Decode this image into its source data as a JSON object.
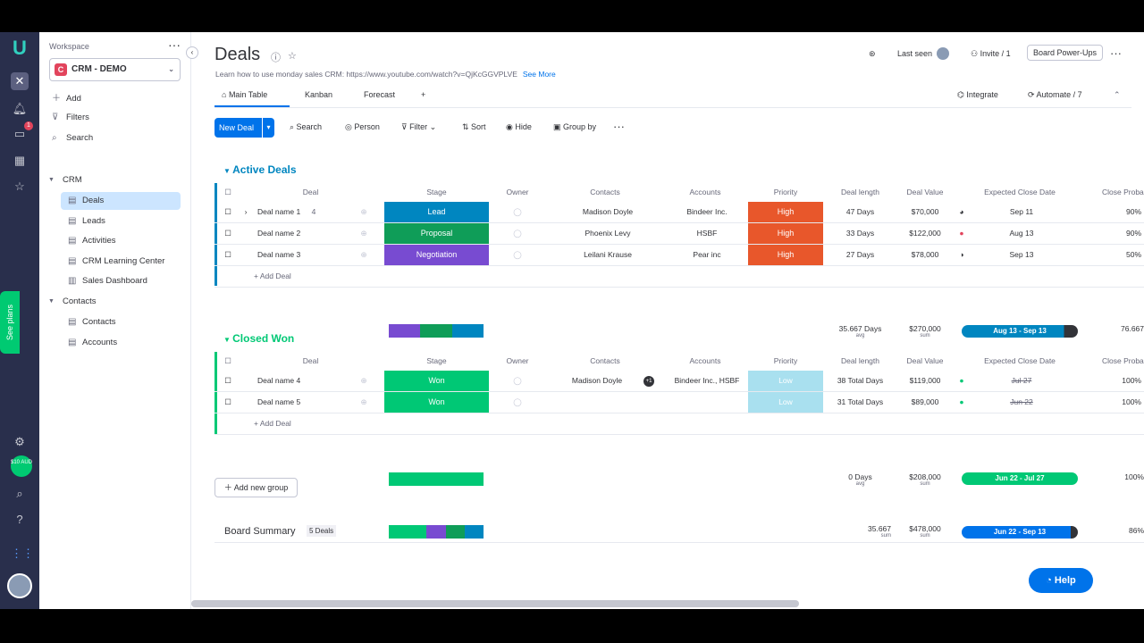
{
  "rail": {
    "badge_count": "1",
    "plan_label": "$10 AUD",
    "see_plans": "See plans"
  },
  "sidebar": {
    "workspace_label": "Workspace",
    "workspace_name": "CRM - DEMO",
    "workspace_initial": "C",
    "actions": [
      {
        "label": "Add"
      },
      {
        "label": "Filters"
      },
      {
        "label": "Search"
      }
    ],
    "folders": [
      {
        "label": "CRM",
        "items": [
          {
            "label": "Deals"
          },
          {
            "label": "Leads"
          },
          {
            "label": "Activities"
          },
          {
            "label": "CRM Learning Center"
          },
          {
            "label": "Sales Dashboard"
          }
        ]
      },
      {
        "label": "Contacts",
        "items": [
          {
            "label": "Contacts"
          },
          {
            "label": "Accounts"
          }
        ]
      }
    ]
  },
  "header": {
    "title": "Deals",
    "description": "Learn how to use monday sales CRM: https://www.youtube.com/watch?v=QjKcGGVPLVE",
    "see_more": "See More",
    "last_seen": "Last seen",
    "invite": "Invite / 1",
    "power_ups": "Board Power-Ups",
    "integrate": "Integrate",
    "automate": "Automate / 7"
  },
  "tabs": [
    {
      "label": "Main Table"
    },
    {
      "label": "Kanban"
    },
    {
      "label": "Forecast"
    },
    {
      "label": "+"
    }
  ],
  "toolbar": {
    "new_deal": "New Deal",
    "search": "Search",
    "person": "Person",
    "filter": "Filter",
    "sort": "Sort",
    "hide": "Hide",
    "group_by": "Group by"
  },
  "columns": {
    "deal": "Deal",
    "stage": "Stage",
    "owner": "Owner",
    "contacts": "Contacts",
    "accounts": "Accounts",
    "priority": "Priority",
    "deal_length": "Deal length",
    "deal_value": "Deal Value",
    "close_date": "Expected Close Date",
    "close_prob": "Close Proba"
  },
  "groups": [
    {
      "title": "Active Deals",
      "color": "#0086c0",
      "rows": [
        {
          "deal": "Deal name 1",
          "subitems": "4",
          "stage": "Lead",
          "stage_color": "#0086c0",
          "contacts": "Madison Doyle",
          "accounts": "Bindeer Inc.",
          "priority": "High",
          "priority_color": "#e8572b",
          "length": "47 Days",
          "value": "$70,000",
          "date": "Sep 11",
          "prob": "90%"
        },
        {
          "deal": "Deal name 2",
          "subitems": "",
          "stage": "Proposal",
          "stage_color": "#0f9d58",
          "contacts": "Phoenix Levy",
          "accounts": "HSBF",
          "priority": "High",
          "priority_color": "#e8572b",
          "length": "33 Days",
          "value": "$122,000",
          "date": "Aug 13",
          "prob": "90%"
        },
        {
          "deal": "Deal name 3",
          "subitems": "",
          "stage": "Negotiation",
          "stage_color": "#784bd1",
          "contacts": "Leilani Krause",
          "accounts": "Pear inc",
          "priority": "High",
          "priority_color": "#e8572b",
          "length": "27 Days",
          "value": "$78,000",
          "date": "Sep 13",
          "prob": "50%"
        }
      ],
      "add_label": "+ Add Deal",
      "sum_length": "35.667 Days",
      "sum_length_sub": "avg",
      "sum_value": "$270,000",
      "sum_value_sub": "sum",
      "sum_date": "Aug 13 - Sep 13",
      "sum_prob": "76.667"
    },
    {
      "title": "Closed Won",
      "color": "#00c875",
      "rows": [
        {
          "deal": "Deal name 4",
          "subitems": "",
          "stage": "Won",
          "stage_color": "#00c875",
          "contacts": "Madison Doyle",
          "contacts_more": "+1",
          "accounts": "Bindeer Inc., HSBF",
          "priority": "Low",
          "priority_color": "#a9e0ef",
          "length": "38 Total Days",
          "value": "$119,000",
          "date": "Jul 27",
          "prob": "100%"
        },
        {
          "deal": "Deal name 5",
          "subitems": "",
          "stage": "Won",
          "stage_color": "#00c875",
          "contacts": "",
          "contacts_more": "",
          "accounts": "",
          "priority": "Low",
          "priority_color": "#a9e0ef",
          "length": "31 Total Days",
          "value": "$89,000",
          "date": "Jun 22",
          "prob": "100%"
        }
      ],
      "add_label": "+ Add Deal",
      "sum_length": "0 Days",
      "sum_length_sub": "avg",
      "sum_value": "$208,000",
      "sum_value_sub": "sum",
      "sum_date": "Jun 22 - Jul 27",
      "sum_prob": "100%"
    }
  ],
  "add_group": "Add new group",
  "board_summary": {
    "label": "Board Summary",
    "count": "5 Deals",
    "length": "35.667",
    "length_sub": "sum",
    "value": "$478,000",
    "value_sub": "sum",
    "date": "Jun 22 - Sep 13",
    "prob": "86%"
  },
  "help": "Help"
}
